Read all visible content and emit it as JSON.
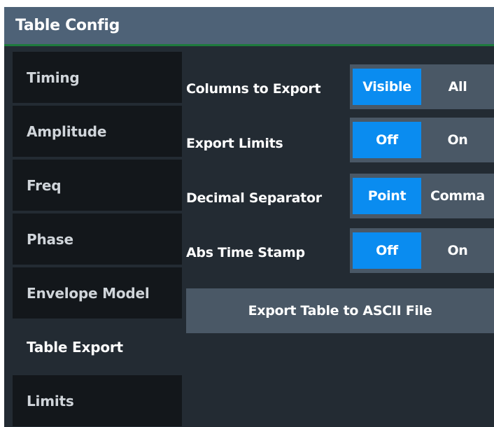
{
  "dialog": {
    "title": "Table Config"
  },
  "tabs": [
    {
      "label": "Timing"
    },
    {
      "label": "Amplitude"
    },
    {
      "label": "Freq"
    },
    {
      "label": "Phase"
    },
    {
      "label": "Envelope Model"
    },
    {
      "label": "Table Export",
      "active": true
    },
    {
      "label": "Limits"
    }
  ],
  "settings": {
    "columns_to_export": {
      "label": "Columns to Export",
      "options": [
        "Visible",
        "All"
      ],
      "selected": "Visible"
    },
    "export_limits": {
      "label": "Export Limits",
      "options": [
        "Off",
        "On"
      ],
      "selected": "Off"
    },
    "decimal_separator": {
      "label": "Decimal Separator",
      "options": [
        "Point",
        "Comma"
      ],
      "selected": "Point"
    },
    "abs_time_stamp": {
      "label": "Abs Time Stamp",
      "options": [
        "Off",
        "On"
      ],
      "selected": "Off"
    }
  },
  "export_button": {
    "label": "Export Table to ASCII File"
  },
  "colors": {
    "accent": "#0a8cf0",
    "titlebar": "#4e6277",
    "panel": "#232b33",
    "tab_inactive": "#13171b"
  }
}
